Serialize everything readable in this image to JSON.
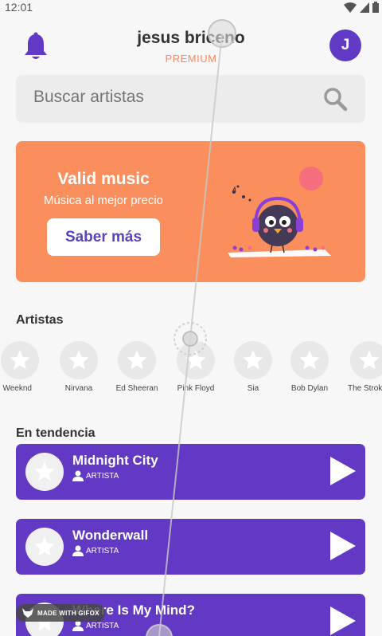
{
  "status": {
    "time": "12:01"
  },
  "header": {
    "user_name": "jesus briceno",
    "plan": "PREMIUM",
    "avatar_initial": "J"
  },
  "search": {
    "placeholder": "Buscar artistas"
  },
  "banner": {
    "title": "Valid music",
    "subtitle": "Música al mejor precio",
    "button_label": "Saber más"
  },
  "artists": {
    "title": "Artistas",
    "items": [
      {
        "name": "Weeknd"
      },
      {
        "name": "Nirvana"
      },
      {
        "name": "Ed Sheeran"
      },
      {
        "name": "Pink Floyd"
      },
      {
        "name": "Sia"
      },
      {
        "name": "Bob Dylan"
      },
      {
        "name": "The Strokes"
      }
    ]
  },
  "trending": {
    "title": "En tendencia",
    "tracks": [
      {
        "title": "Midnight City",
        "artist": "ARTISTA"
      },
      {
        "title": "Wonderwall",
        "artist": "ARTISTA"
      },
      {
        "title": "Where Is My Mind?",
        "artist": "ARTISTA"
      }
    ]
  },
  "watermark": {
    "label": "MADE WITH GIFOX"
  },
  "colors": {
    "primary": "#6139c4",
    "accent": "#fa8f5d",
    "premium": "#f58a63",
    "background": "#f7f7f7"
  },
  "icons": [
    "bell-icon",
    "search-icon",
    "star-icon",
    "play-icon",
    "user-icon",
    "wifi-icon",
    "signal-icon",
    "battery-icon"
  ]
}
